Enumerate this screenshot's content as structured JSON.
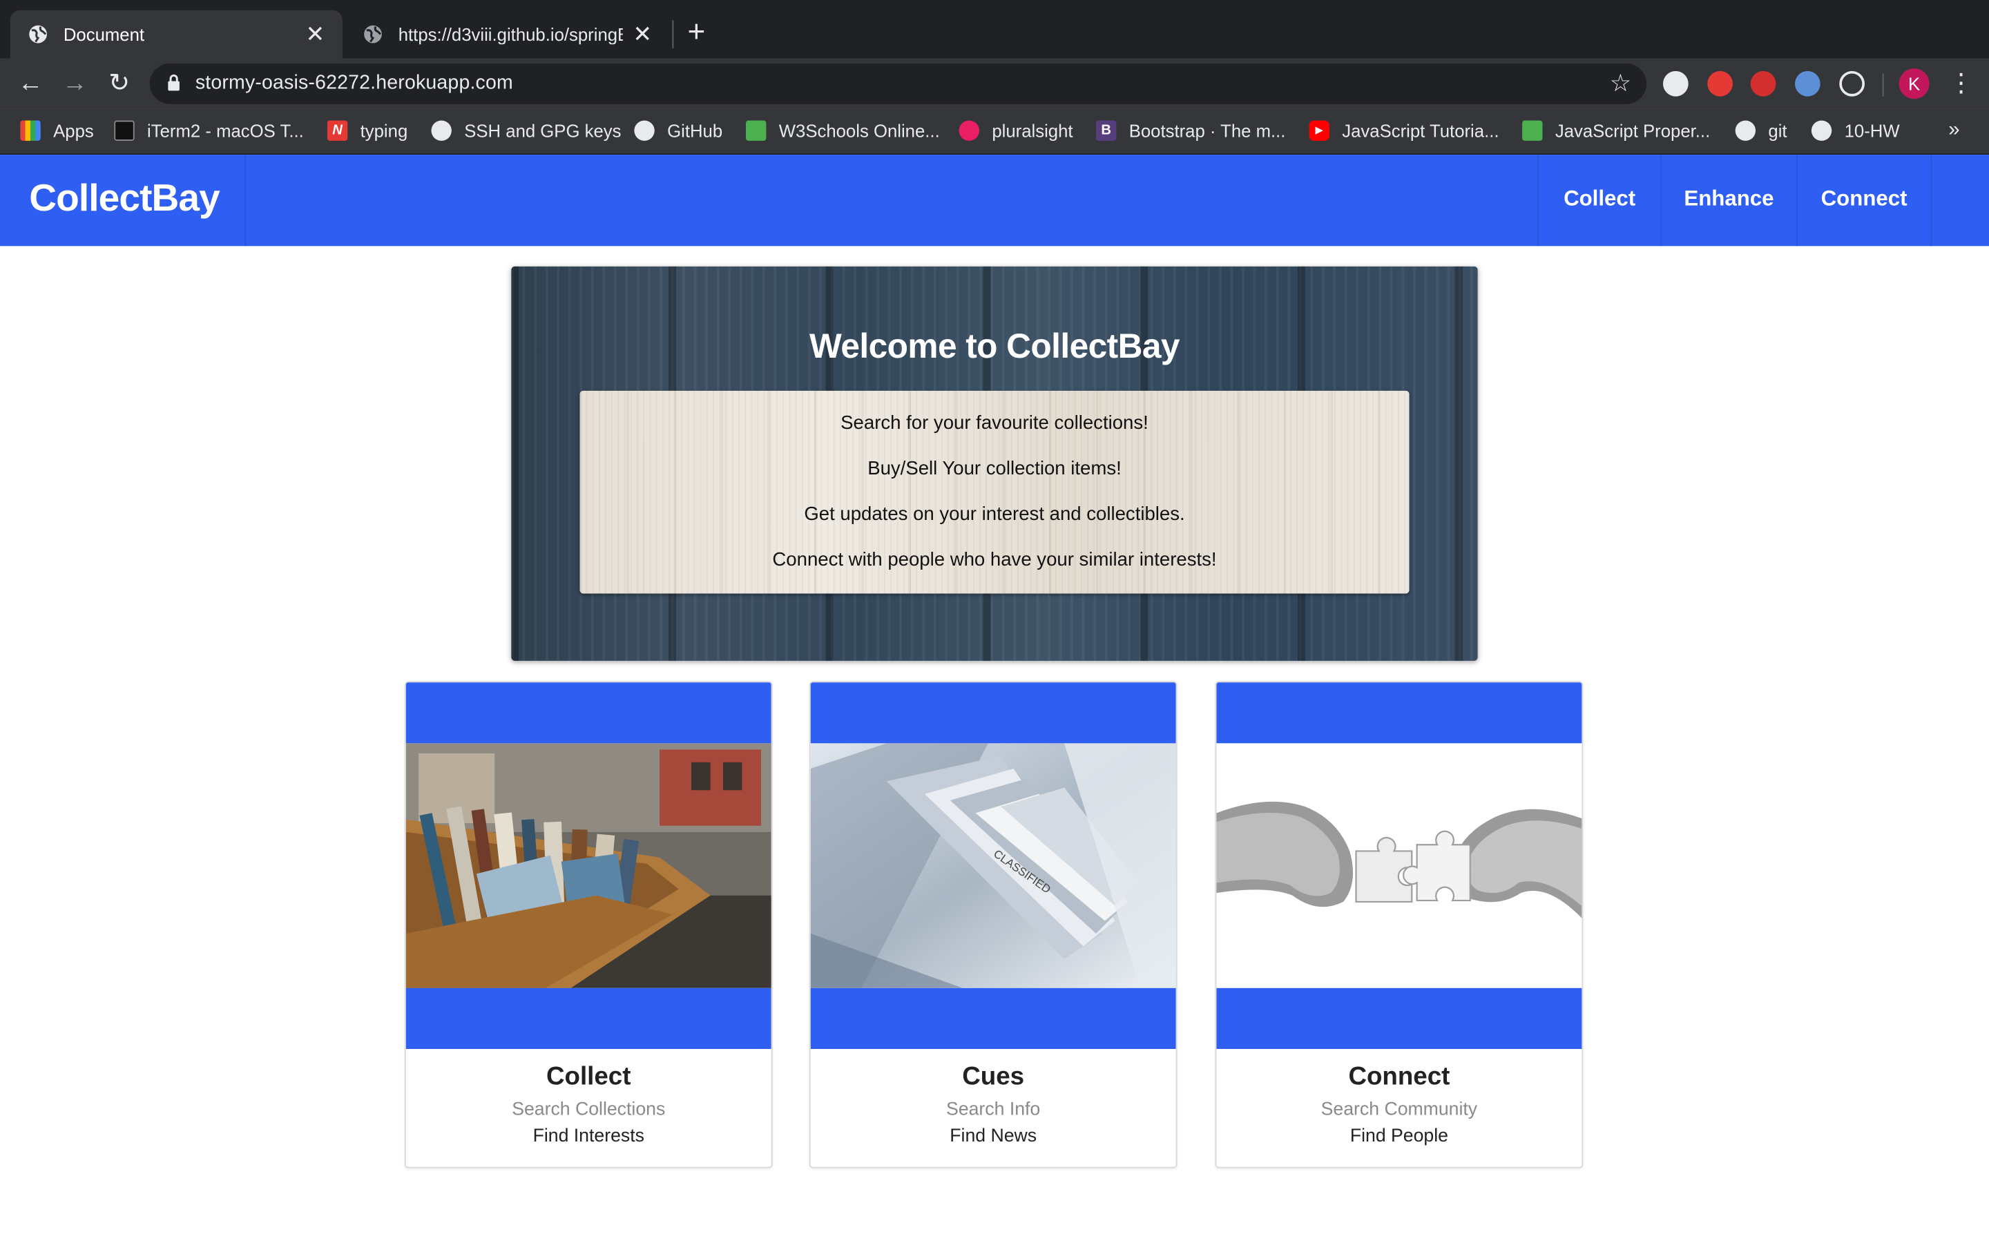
{
  "browser": {
    "tabs": [
      {
        "title": "Document",
        "active": true
      },
      {
        "title": "https://d3viii.github.io/springB",
        "active": false
      }
    ],
    "new_tab": "+",
    "close_glyph": "✕",
    "url": "stormy-oasis-62272.herokuapp.com",
    "profile_initial": "K",
    "bookmarks": [
      {
        "label": "Apps",
        "icon": "apps-grid-icon"
      },
      {
        "label": "iTerm2 - macOS T...",
        "icon": "iterm-icon"
      },
      {
        "label": "typing",
        "icon": "n-logo-icon"
      },
      {
        "label": "SSH and GPG keys",
        "icon": "github-icon"
      },
      {
        "label": "GitHub",
        "icon": "github-icon"
      },
      {
        "label": "W3Schools Online...",
        "icon": "w3schools-icon"
      },
      {
        "label": "pluralsight",
        "icon": "pluralsight-icon"
      },
      {
        "label": "Bootstrap · The m...",
        "icon": "bootstrap-icon"
      },
      {
        "label": "JavaScript Tutoria...",
        "icon": "youtube-icon"
      },
      {
        "label": "JavaScript Proper...",
        "icon": "w3schools-icon"
      },
      {
        "label": "git",
        "icon": "github-icon"
      },
      {
        "label": "10-HW",
        "icon": "github-icon"
      }
    ],
    "bookmarks_overflow": "»"
  },
  "site": {
    "brand": "CollectBay",
    "nav": [
      "Collect",
      "Enhance",
      "Connect"
    ],
    "colors": {
      "primary": "#2f5ef2",
      "text_dark": "#222222",
      "text_muted": "#8a8a8a"
    }
  },
  "hero": {
    "title": "Welcome to CollectBay",
    "lines": [
      "Search for your favourite collections!",
      "Buy/Sell Your collection items!",
      "Get updates on your interest and collectibles.",
      "Connect with people who have your similar interests!"
    ]
  },
  "cards": [
    {
      "title": "Collect",
      "subtitle": "Search Collections",
      "line": "Find Interests",
      "image": "books-in-crates-photo"
    },
    {
      "title": "Cues",
      "subtitle": "Search Info",
      "line": "Find News",
      "image": "newspapers-classified-photo"
    },
    {
      "title": "Connect",
      "subtitle": "Search Community",
      "line": "Find People",
      "image": "hands-puzzle-pieces-photo"
    }
  ]
}
